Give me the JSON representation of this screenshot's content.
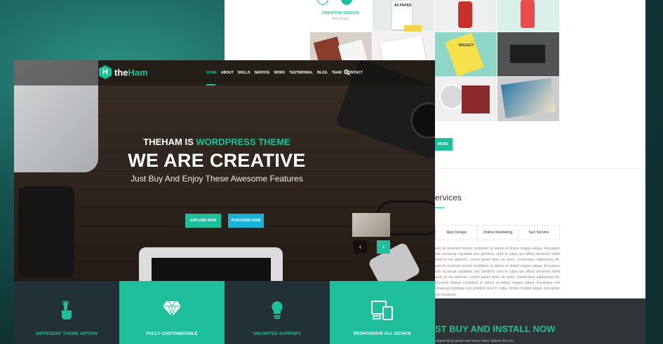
{
  "back_page": {
    "portfolio": {
      "item_title": "CREATIVE DESIGN",
      "item_subtitle": "Web Design",
      "tile_label": "A4 PAPER",
      "tile_label_2": "MAGAZY",
      "load_more": "MORE"
    },
    "services": {
      "title": "ervices",
      "tabs": [
        "App Design",
        "Online Marketing",
        "Seo Service"
      ],
      "body": "sed do eiusmod tempor incididunt ut labore et dolore magna aliqua. Excepteur sint occaecat cupidatat non proident, sunt in culpa qui officia deserunt mollit anim id est laborum. Lorem ipsum dolor sit amet, consectetur adipisicing elit, sed do eiusmod tempor incididunt ut labore et dolore magna aliqua. Excepteur sint occaecat cupidatat non proident, sunt in culpa qui officia deserunt mollit anim id est laborum. Lorem ipsum dolor sit amet, consectetur adipisicing elit. Eiusmod tempor incididunt ut labore et dolore magna aliqua. Excepteur sint occaecat cupidatat non proident sunt in culpa. Dolore magna aliqua. Excepteur sint occaecat."
    },
    "install": {
      "title": "ST BUY AND INSTALL NOW",
      "subtitle": "unique blog layout and many many options for you"
    }
  },
  "front_page": {
    "logo": {
      "letter": "H",
      "name_prefix": "the",
      "name_suffix": "Ham"
    },
    "menu": [
      "HOME",
      "ABOUT",
      "SKILLS",
      "SERVICE",
      "WORK",
      "TESTIMONIAL",
      "BLOG",
      "TEAM",
      "CONTACT"
    ],
    "active_menu": "HOME",
    "hero": {
      "kicker_prefix": "THEHAM IS ",
      "kicker_highlight": "WORDPRESS THEME",
      "title": "WE ARE CREATIVE",
      "subtitle": "Just Buy And Enjoy These Awesome Features",
      "explore_button": "EXPLORE NOW",
      "purchase_button": "PURCHASE NOW",
      "prev_arrow": "‹",
      "next_arrow": "›"
    },
    "features": [
      {
        "label": "DIFFERENT THEME OPTION",
        "icon": "hand-pointer-icon",
        "style": "dark"
      },
      {
        "label": "FULLY CUSTOMIZABLE",
        "icon": "diamond-icon",
        "style": "teal"
      },
      {
        "label": "UNLIMITED SUPPORT",
        "icon": "lightbulb-icon",
        "style": "dark"
      },
      {
        "label": "RESPONSIVE ALL DEVICE",
        "icon": "devices-icon",
        "style": "teal"
      }
    ]
  },
  "colors": {
    "accent": "#1fbf9b",
    "accent_blue": "#1ab3d8",
    "dark": "#213137",
    "background": "#0f2f31"
  }
}
